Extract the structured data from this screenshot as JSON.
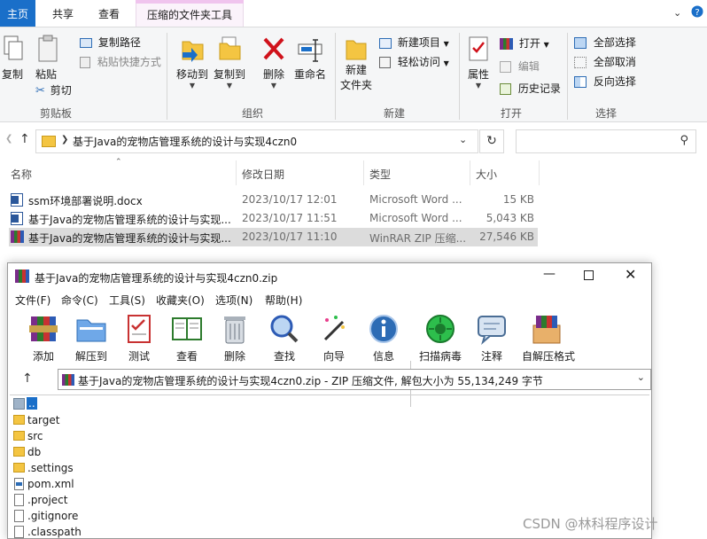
{
  "explorer": {
    "tabs": [
      "主页",
      "共享",
      "查看",
      "压缩的文件夹工具"
    ],
    "ribbon": {
      "clipboard": {
        "label": "剪贴板",
        "copy": "复制",
        "paste": "粘贴",
        "copy_path": "复制路径",
        "paste_shortcut": "粘贴快捷方式",
        "cut": "剪切"
      },
      "organize": {
        "label": "组织",
        "move_to": "移动到",
        "copy_to": "复制到",
        "delete": "删除",
        "rename": "重命名"
      },
      "new": {
        "label": "新建",
        "new_item": "新建项目",
        "easy_access": "轻松访问",
        "new_folder": "新建\n文件夹"
      },
      "open": {
        "label": "打开",
        "properties": "属性",
        "open": "打开",
        "edit": "编辑",
        "history": "历史记录"
      },
      "select": {
        "label": "选择",
        "select_all": "全部选择",
        "select_none": "全部取消",
        "invert": "反向选择"
      }
    },
    "address": "基于Java的宠物店管理系统的设计与实现4czn0",
    "columns": {
      "name": "名称",
      "date": "修改日期",
      "type": "类型",
      "size": "大小"
    },
    "files": [
      {
        "name": "ssm环境部署说明.docx",
        "date": "2023/10/17 12:01",
        "type": "Microsoft Word ...",
        "size": "15 KB",
        "icon": "word-icon"
      },
      {
        "name": "基于Java的宠物店管理系统的设计与实现...",
        "date": "2023/10/17 11:51",
        "type": "Microsoft Word ...",
        "size": "5,043 KB",
        "icon": "word-icon"
      },
      {
        "name": "基于Java的宠物店管理系统的设计与实现...",
        "date": "2023/10/17 11:10",
        "type": "WinRAR ZIP 压缩...",
        "size": "27,546 KB",
        "icon": "winrar-icon"
      }
    ]
  },
  "winrar": {
    "title": "基于Java的宠物店管理系统的设计与实现4czn0.zip",
    "menu": [
      "文件(F)",
      "命令(C)",
      "工具(S)",
      "收藏夹(O)",
      "选项(N)",
      "帮助(H)"
    ],
    "tools": [
      "添加",
      "解压到",
      "测试",
      "查看",
      "删除",
      "查找",
      "向导",
      "信息",
      "扫描病毒",
      "注释",
      "自解压格式"
    ],
    "path": "基于Java的宠物店管理系统的设计与实现4czn0.zip - ZIP 压缩文件, 解包大小为 55,134,249 字节",
    "entries": [
      {
        "name": "..",
        "kind": "up"
      },
      {
        "name": "target",
        "kind": "folder"
      },
      {
        "name": "src",
        "kind": "folder"
      },
      {
        "name": "db",
        "kind": "folder"
      },
      {
        "name": ".settings",
        "kind": "folder"
      },
      {
        "name": "pom.xml",
        "kind": "xml"
      },
      {
        "name": ".project",
        "kind": "file"
      },
      {
        "name": ".gitignore",
        "kind": "file"
      },
      {
        "name": ".classpath",
        "kind": "file"
      }
    ]
  },
  "watermark": "CSDN @林科程序设计"
}
